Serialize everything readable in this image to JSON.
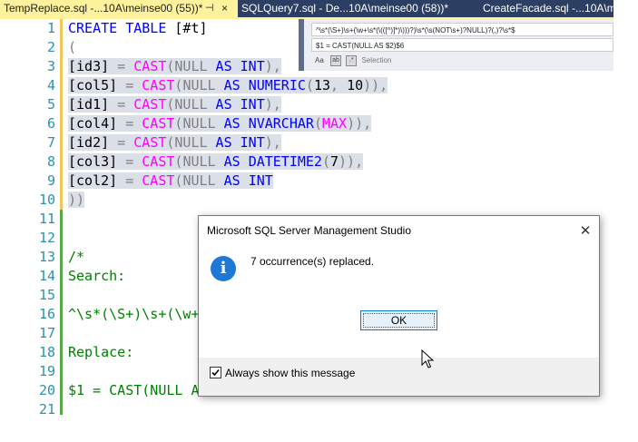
{
  "tabs": [
    {
      "label": "TempReplace.sql -...10A\\meinse00 (55))*",
      "pin": "⊣",
      "close": "×"
    },
    {
      "label": "SQLQuery7.sql - De...10A\\meinse00 (58))*"
    },
    {
      "label": "CreateFacade.sql -...10A\\meinse00 (5"
    }
  ],
  "editor": {
    "line_numbers": [
      "1",
      "2",
      "3",
      "4",
      "5",
      "6",
      "7",
      "8",
      "9",
      "10",
      "11",
      "12",
      "13",
      "14",
      "15",
      "16",
      "17",
      "18",
      "19",
      "20",
      "21"
    ],
    "lines": {
      "l1": {
        "a": "CREATE",
        "b": " ",
        "c": "TABLE",
        "d": " [#t]"
      },
      "l2": "(",
      "l3": {
        "id": "[id3]",
        "eq": " = ",
        "fn": "CAST",
        "p1": "(",
        "null": "NULL",
        "as": " AS ",
        "type": "INT",
        "p2": "),"
      },
      "l4": {
        "id": "[col5]",
        "eq": " = ",
        "fn": "CAST",
        "p1": "(",
        "null": "NULL",
        "as": " AS ",
        "type": "NUMERIC",
        "p2": "(",
        "n1": "13",
        "comma": ", ",
        "n2": "10",
        "p3": ")),"
      },
      "l5": {
        "id": "[id1]",
        "eq": " = ",
        "fn": "CAST",
        "p1": "(",
        "null": "NULL",
        "as": " AS ",
        "type": "INT",
        "p2": "),"
      },
      "l6": {
        "id": "[col4]",
        "eq": " = ",
        "fn": "CAST",
        "p1": "(",
        "null": "NULL",
        "as": " AS ",
        "type": "NVARCHAR",
        "p2": "(",
        "max": "MAX",
        "p3": ")),"
      },
      "l7": {
        "id": "[id2]",
        "eq": " = ",
        "fn": "CAST",
        "p1": "(",
        "null": "NULL",
        "as": " AS ",
        "type": "INT",
        "p2": "),"
      },
      "l8": {
        "id": "[col3]",
        "eq": " = ",
        "fn": "CAST",
        "p1": "(",
        "null": "NULL",
        "as": " AS ",
        "type": "DATETIME2",
        "p2": "(",
        "n1": "7",
        "p3": ")),"
      },
      "l9": {
        "id": "[col2]",
        "eq": " = ",
        "fn": "CAST",
        "p1": "(",
        "null": "NULL",
        "as": " AS ",
        "type": "INT"
      },
      "l10": "))",
      "l13": "/*",
      "l14": "Search:",
      "l16": "^\\s*(\\S+)\\s+(\\w+",
      "l18": "Replace:",
      "l20": "$1 = CAST(NULL A"
    }
  },
  "find_replace": {
    "search_value": "^\\s*(\\S+)\\s+(\\w+\\s*(\\(([^)]*)\\)))?)\\s*(\\s(NOT\\s+)?NULL)?(,)?\\s*$",
    "replace_value": "$1 = CAST(NULL AS $2)$6",
    "options": [
      "Aa",
      "ab",
      ".*"
    ],
    "scope_label": "Selection"
  },
  "dialog": {
    "title": "Microsoft SQL Server Management Studio",
    "close": "✕",
    "icon": "info-icon",
    "icon_glyph": "i",
    "message": "7 occurrence(s) replaced.",
    "ok_label": "OK",
    "checkbox_label": "Always show this message",
    "checkbox_checked": true
  },
  "colors": {
    "keyword": "#0000ff",
    "function": "#ff00ff",
    "line_number": "#2b91af",
    "comment": "#008000",
    "active_tab": "#fff29d",
    "tab_bar": "#2d3e63"
  }
}
